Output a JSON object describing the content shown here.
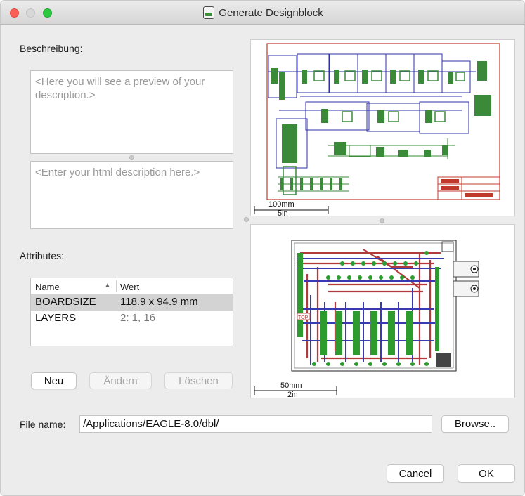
{
  "window": {
    "title": "Generate Designblock",
    "controls": [
      "close",
      "minimize",
      "zoom"
    ],
    "app_icon": "eagle-designblock-icon"
  },
  "description": {
    "label": "Beschreibung:",
    "preview_text": "<Here you will see a preview of your description.>",
    "editor_placeholder": "<Enter your html description here.>"
  },
  "attributes": {
    "label": "Attributes:",
    "columns": {
      "name": "Name",
      "value": "Wert",
      "sort_indicator": "▲"
    },
    "rows": [
      {
        "name": "BOARDSIZE",
        "value": "118.9 x 94.9 mm",
        "selected": true
      },
      {
        "name": "LAYERS",
        "value": "2: 1, 16",
        "selected": false
      }
    ],
    "buttons": {
      "new": "Neu",
      "edit": "Ändern",
      "delete": "Löschen"
    }
  },
  "schematic_preview": {
    "scale_mm": "100mm",
    "scale_in": "5in"
  },
  "board_preview": {
    "scale_mm": "50mm",
    "scale_in": "2in",
    "layer_tag": "TOP"
  },
  "file": {
    "label": "File name:",
    "value": "/Applications/EAGLE-8.0/dbl/",
    "browse_label": "Browse.."
  },
  "footer": {
    "cancel_label": "Cancel",
    "ok_label": "OK"
  },
  "colors": {
    "schematic_frame": "#c0392b",
    "schematic_net": "#2f2fa8",
    "schematic_part": "#3a8a3a",
    "board_top": "#b23a3a",
    "board_bottom": "#3a3ab0",
    "board_pad": "#2e9b2e"
  }
}
